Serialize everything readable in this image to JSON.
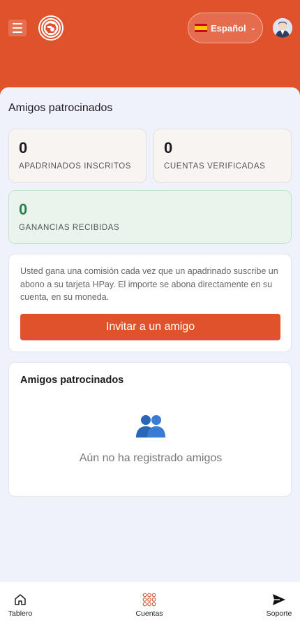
{
  "header": {
    "language": {
      "flag": "es-flag-icon",
      "label": "Español"
    },
    "colors": {
      "brand": "#e0522c",
      "success": "#2e7d4f"
    }
  },
  "main": {
    "title": "Amigos patrocinados",
    "stats": [
      {
        "value": "0",
        "label": "APADRINADOS INSCRITOS"
      },
      {
        "value": "0",
        "label": "CUENTAS VERIFICADAS"
      },
      {
        "value": "0",
        "label": "GANANCIAS RECIBIDAS"
      }
    ],
    "info": {
      "text": "Usted gana una comisión cada vez que un apadrinado suscribe un abono a su tarjeta HPay. El importe se abona directamente en su cuenta, en su moneda.",
      "button": "Invitar a un amigo"
    },
    "friends": {
      "title": "Amigos patrocinados",
      "empty": "Aún no ha registrado amigos"
    }
  },
  "nav": {
    "items": [
      {
        "label": "Tablero",
        "icon": "home-icon"
      },
      {
        "label": "Cuentas",
        "icon": "grid-dots-icon"
      },
      {
        "label": "Soporte",
        "icon": "send-icon"
      }
    ]
  }
}
